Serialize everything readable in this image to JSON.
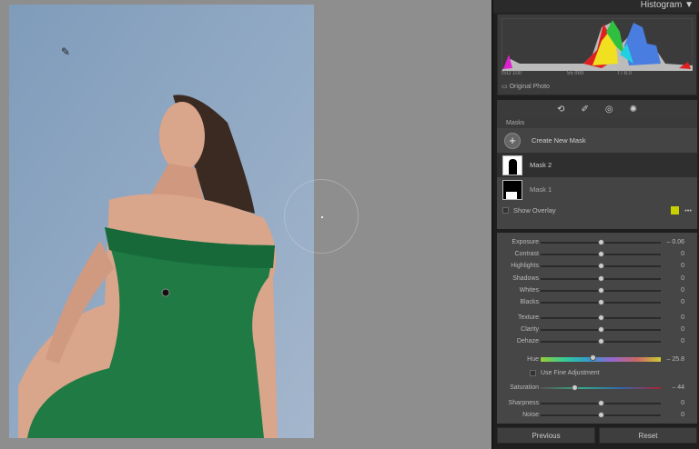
{
  "panel": {
    "histogram_title": "Histogram",
    "collapse_icon": "triangle-down",
    "histogram_meta": {
      "iso": "ISO 100",
      "focal": "55 mm",
      "aperture": "f / 8.0"
    },
    "original_photo": "Original Photo"
  },
  "masks": {
    "title": "Masks",
    "create_label": "Create New Mask",
    "items": [
      {
        "label": "Mask 2",
        "selected": true
      },
      {
        "label": "Mask 1",
        "selected": false
      }
    ],
    "show_overlay": "Show Overlay",
    "overlay_color": "#c8d000"
  },
  "adjust": {
    "sliders": [
      {
        "label": "Exposure",
        "value": "– 0.06",
        "pos": 0.5
      },
      {
        "label": "Contrast",
        "value": "0",
        "pos": 0.5
      },
      {
        "label": "Highlights",
        "value": "0",
        "pos": 0.5
      },
      {
        "label": "Shadows",
        "value": "0",
        "pos": 0.5
      },
      {
        "label": "Whites",
        "value": "0",
        "pos": 0.5
      },
      {
        "label": "Blacks",
        "value": "0",
        "pos": 0.5
      },
      {
        "label": "Texture",
        "value": "0",
        "pos": 0.5
      },
      {
        "label": "Clarity",
        "value": "0",
        "pos": 0.5
      },
      {
        "label": "Dehaze",
        "value": "0",
        "pos": 0.5
      },
      {
        "label": "Hue",
        "value": "– 25.8",
        "pos": 0.43
      },
      {
        "label": "Saturation",
        "value": "– 44",
        "pos": 0.28
      },
      {
        "label": "Sharpness",
        "value": "0",
        "pos": 0.5
      },
      {
        "label": "Noise",
        "value": "0",
        "pos": 0.5
      }
    ],
    "fine_adjustment": "Use Fine Adjustment"
  },
  "buttons": {
    "previous": "Previous",
    "reset": "Reset"
  }
}
